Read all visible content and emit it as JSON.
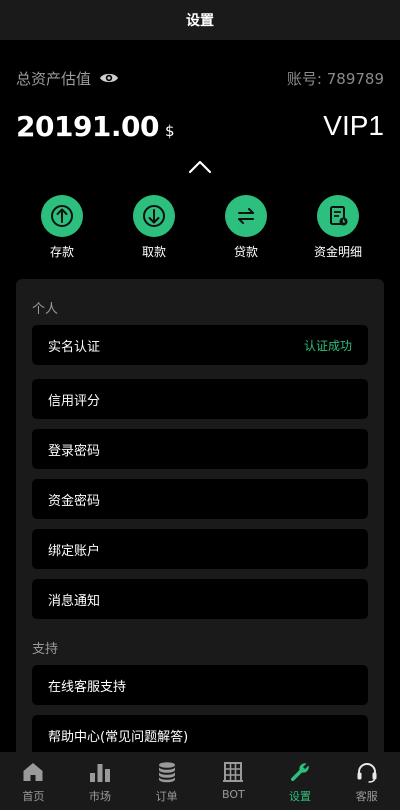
{
  "header": {
    "title": "设置"
  },
  "assets": {
    "label": "总资产估值",
    "account": "账号: 789789",
    "balance": "20191.00",
    "currency": "$",
    "vip": "VIP1"
  },
  "actions": [
    {
      "label": "存款",
      "icon": "deposit-icon"
    },
    {
      "label": "取款",
      "icon": "withdraw-icon"
    },
    {
      "label": "贷款",
      "icon": "loan-icon"
    },
    {
      "label": "资金明细",
      "icon": "statement-icon"
    }
  ],
  "sections": {
    "personal": {
      "title": "个人",
      "items": [
        {
          "label": "实名认证",
          "status": "认证成功"
        },
        {
          "label": "信用评分"
        },
        {
          "label": "登录密码"
        },
        {
          "label": "资金密码"
        },
        {
          "label": "绑定账户"
        },
        {
          "label": "消息通知"
        }
      ]
    },
    "support": {
      "title": "支持",
      "items": [
        {
          "label": "在线客服支持"
        },
        {
          "label": "帮助中心(常见问题解答)"
        }
      ]
    }
  },
  "tabs": [
    {
      "label": "首页",
      "icon": "home-icon"
    },
    {
      "label": "市场",
      "icon": "market-icon"
    },
    {
      "label": "订单",
      "icon": "orders-icon"
    },
    {
      "label": "BOT",
      "icon": "bot-icon"
    },
    {
      "label": "设置",
      "icon": "settings-wrench-icon",
      "active": true
    },
    {
      "label": "客服",
      "icon": "headset-icon"
    }
  ],
  "colors": {
    "accent": "#2dbf7e",
    "background": "#000000",
    "card": "#1a1a1a",
    "muted": "#9a9a9a"
  }
}
